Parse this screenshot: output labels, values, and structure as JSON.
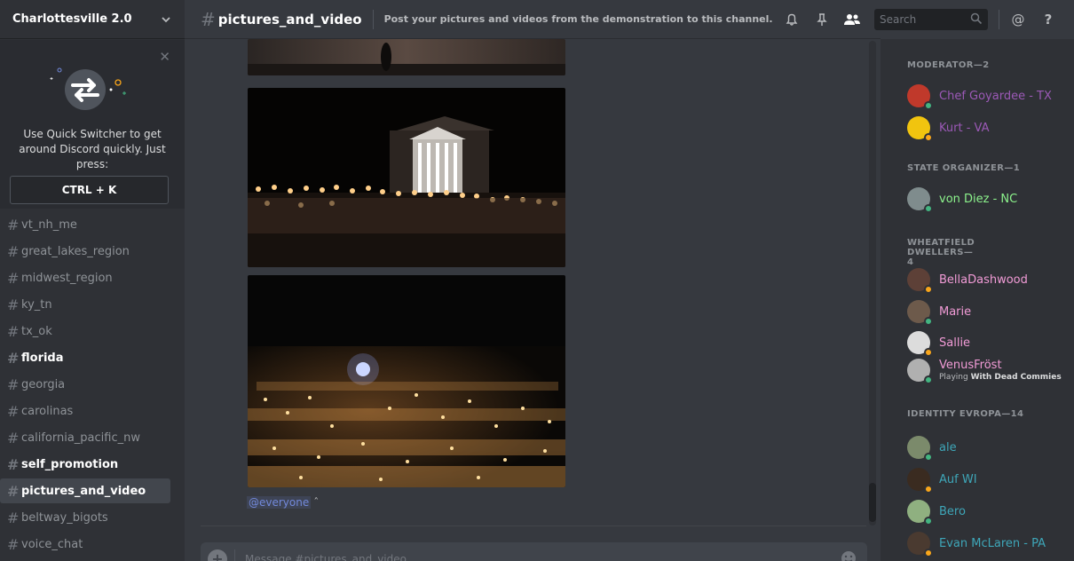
{
  "guild": {
    "name": "Charlottesville 2.0"
  },
  "quick_switcher": {
    "text": "Use Quick Switcher to get around Discord quickly. Just press:",
    "shortcut": "CTRL + K"
  },
  "channels": [
    {
      "name": "vt_nh_me",
      "state": "read"
    },
    {
      "name": "great_lakes_region",
      "state": "read"
    },
    {
      "name": "midwest_region",
      "state": "read"
    },
    {
      "name": "ky_tn",
      "state": "read"
    },
    {
      "name": "tx_ok",
      "state": "read"
    },
    {
      "name": "florida",
      "state": "unread"
    },
    {
      "name": "georgia",
      "state": "read"
    },
    {
      "name": "carolinas",
      "state": "read"
    },
    {
      "name": "california_pacific_nw",
      "state": "read"
    },
    {
      "name": "self_promotion",
      "state": "unread"
    },
    {
      "name": "pictures_and_video",
      "state": "active"
    },
    {
      "name": "beltway_bigots",
      "state": "read"
    },
    {
      "name": "voice_chat",
      "state": "read"
    }
  ],
  "channel_header": {
    "name": "pictures_and_video",
    "topic": "Post your pictures and videos from the demonstration to this channel."
  },
  "toolbar": {
    "search_placeholder": "Search"
  },
  "message": {
    "mention": "@everyone",
    "mark": "ˆ"
  },
  "composer": {
    "placeholder": "Message #pictures_and_video"
  },
  "members": {
    "groups": [
      {
        "label": "MODERATOR—2",
        "members": [
          {
            "name": "Chef Goyardee - TX",
            "color": "#9b59b6",
            "status": "online"
          },
          {
            "name": "Kurt - VA",
            "color": "#9b59b6",
            "status": "idle"
          }
        ]
      },
      {
        "label": "STATE ORGANIZER—1",
        "members": [
          {
            "name": "von Diez - NC",
            "color": "#8cf38c",
            "status": "online"
          }
        ]
      },
      {
        "label": "WHEATFIELD DWELLERS—4",
        "members": [
          {
            "name": "BellaDashwood",
            "color": "#f19bd6",
            "status": "idle"
          },
          {
            "name": "Marie",
            "color": "#f19bd6",
            "status": "online"
          },
          {
            "name": "Sallie",
            "color": "#f19bd6",
            "status": "idle"
          },
          {
            "name": "VenusFröst",
            "color": "#f19bd6",
            "status": "online",
            "playing_prefix": "Playing",
            "playing": "With Dead Commies"
          }
        ]
      },
      {
        "label": "IDENTITY EVROPA—14",
        "members": [
          {
            "name": "ale",
            "color": "#3ea6b8",
            "status": "online"
          },
          {
            "name": "Auf WI",
            "color": "#3ea6b8",
            "status": "idle"
          },
          {
            "name": "Bero",
            "color": "#3ea6b8",
            "status": "online"
          },
          {
            "name": "Evan McLaren - PA",
            "color": "#3ea6b8",
            "status": "idle"
          }
        ]
      }
    ]
  }
}
